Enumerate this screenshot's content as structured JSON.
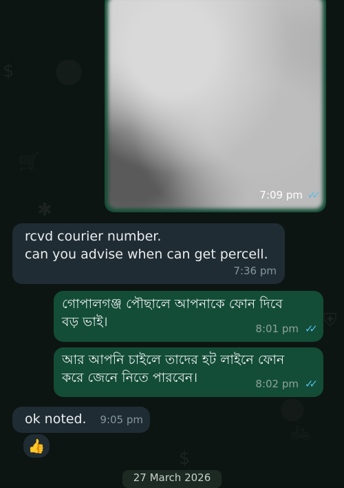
{
  "messages": {
    "image": {
      "time": "7:09 pm",
      "status": "read"
    },
    "m1": {
      "text": "rcvd courier number.\ncan you advise when can get percell.",
      "time": "7:36 pm"
    },
    "m2": {
      "text": "গোপালগঞ্জ পৌছালে আপনাকে ফোন দিবে\nবড় ভাই।",
      "time": "8:01 pm",
      "status": "read"
    },
    "m3": {
      "text": "আর আপনি চাইলে তাদের হট লাইনে ফোন\nকরে জেনে নিতে পারবেন।",
      "time": "8:02 pm",
      "status": "read"
    },
    "m4": {
      "text": "ok noted.",
      "time": "9:05 pm",
      "reaction": "👍"
    }
  },
  "date_separator": "27 March 2026",
  "colors": {
    "outgoing": "#134d37",
    "incoming": "#202c33",
    "read_ticks": "#53bdeb"
  },
  "icons": {
    "read_receipt": "double-check-icon",
    "reaction": "thumbs-up-icon"
  }
}
